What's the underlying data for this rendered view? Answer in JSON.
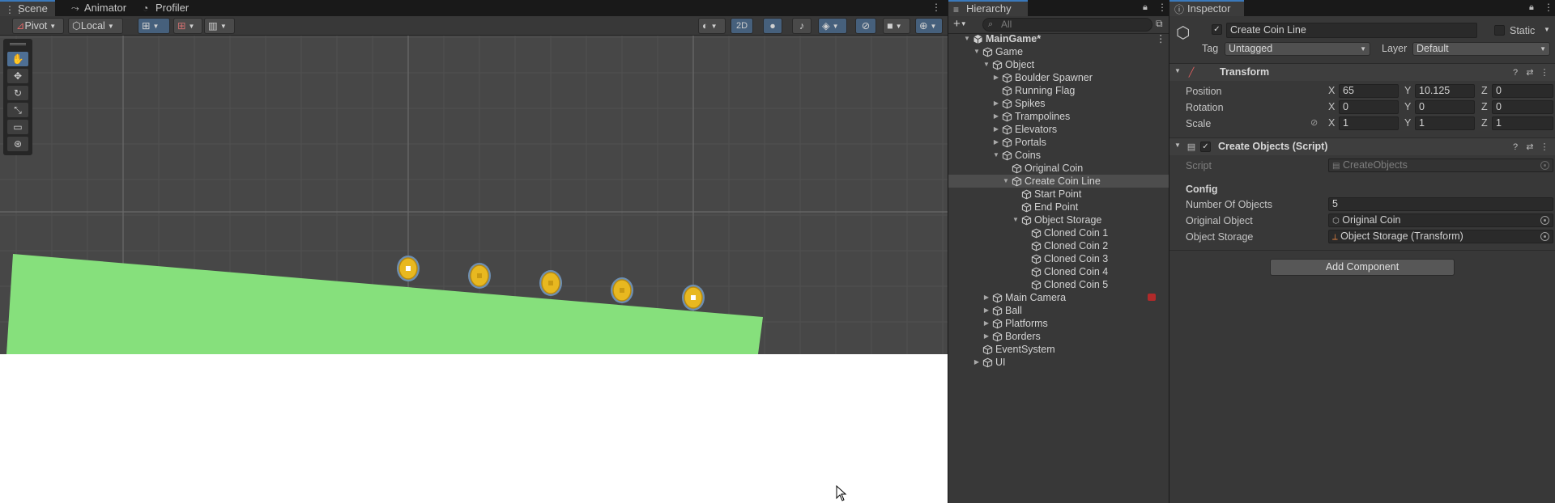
{
  "scene_panel": {
    "tabs": [
      {
        "label": "Scene",
        "icon": "grid-icon",
        "active": true
      },
      {
        "label": "Animator",
        "icon": "animator-icon",
        "active": false
      },
      {
        "label": "Profiler",
        "icon": "profiler-icon",
        "active": false
      }
    ],
    "toolbar": {
      "pivot_label": "Pivot",
      "local_label": "Local",
      "toggle_2d_label": "2D"
    },
    "coins_count": 5
  },
  "hierarchy": {
    "tab_label": "Hierarchy",
    "search_placeholder": "All",
    "rows": [
      {
        "label": "MainGame*",
        "depth": 0,
        "arrow": "open",
        "icon": "scene-icon",
        "bold": true
      },
      {
        "label": "Game",
        "depth": 1,
        "arrow": "open",
        "icon": "cube-icon"
      },
      {
        "label": "Object",
        "depth": 2,
        "arrow": "open",
        "icon": "cube-icon"
      },
      {
        "label": "Boulder Spawner",
        "depth": 3,
        "arrow": "closed",
        "icon": "cube-icon"
      },
      {
        "label": "Running Flag",
        "depth": 3,
        "arrow": "none",
        "icon": "cube-icon"
      },
      {
        "label": "Spikes",
        "depth": 3,
        "arrow": "closed",
        "icon": "cube-icon"
      },
      {
        "label": "Trampolines",
        "depth": 3,
        "arrow": "closed",
        "icon": "cube-icon"
      },
      {
        "label": "Elevators",
        "depth": 3,
        "arrow": "closed",
        "icon": "cube-icon"
      },
      {
        "label": "Portals",
        "depth": 3,
        "arrow": "closed",
        "icon": "cube-icon"
      },
      {
        "label": "Coins",
        "depth": 3,
        "arrow": "open",
        "icon": "cube-icon"
      },
      {
        "label": "Original Coin",
        "depth": 4,
        "arrow": "none",
        "icon": "cube-icon"
      },
      {
        "label": "Create Coin Line",
        "depth": 4,
        "arrow": "open",
        "icon": "cube-icon",
        "selected": true
      },
      {
        "label": "Start Point",
        "depth": 5,
        "arrow": "none",
        "icon": "cube-icon"
      },
      {
        "label": "End Point",
        "depth": 5,
        "arrow": "none",
        "icon": "cube-icon"
      },
      {
        "label": "Object Storage",
        "depth": 5,
        "arrow": "open",
        "icon": "cube-icon"
      },
      {
        "label": "Cloned Coin 1",
        "depth": 6,
        "arrow": "none",
        "icon": "cube-icon"
      },
      {
        "label": "Cloned Coin 2",
        "depth": 6,
        "arrow": "none",
        "icon": "cube-icon"
      },
      {
        "label": "Cloned Coin 3",
        "depth": 6,
        "arrow": "none",
        "icon": "cube-icon"
      },
      {
        "label": "Cloned Coin 4",
        "depth": 6,
        "arrow": "none",
        "icon": "cube-icon"
      },
      {
        "label": "Cloned Coin 5",
        "depth": 6,
        "arrow": "none",
        "icon": "cube-icon"
      },
      {
        "label": "Main Camera",
        "depth": 2,
        "arrow": "closed",
        "icon": "cube-icon",
        "badge": "camera-badge-icon"
      },
      {
        "label": "Ball",
        "depth": 2,
        "arrow": "closed",
        "icon": "cube-icon"
      },
      {
        "label": "Platforms",
        "depth": 2,
        "arrow": "closed",
        "icon": "cube-icon"
      },
      {
        "label": "Borders",
        "depth": 2,
        "arrow": "closed",
        "icon": "cube-icon"
      },
      {
        "label": "EventSystem",
        "depth": 1,
        "arrow": "none",
        "icon": "cube-icon"
      },
      {
        "label": "UI",
        "depth": 1,
        "arrow": "closed",
        "icon": "cube-icon"
      }
    ]
  },
  "inspector": {
    "tab_label": "Inspector",
    "object_name": "Create Coin Line",
    "static_label": "Static",
    "tag_label": "Tag",
    "tag_value": "Untagged",
    "layer_label": "Layer",
    "layer_value": "Default",
    "transform": {
      "title": "Transform",
      "position_label": "Position",
      "rotation_label": "Rotation",
      "scale_label": "Scale",
      "position": {
        "x": "65",
        "y": "10.125",
        "z": "0"
      },
      "rotation": {
        "x": "0",
        "y": "0",
        "z": "0"
      },
      "scale": {
        "x": "1",
        "y": "1",
        "z": "1"
      }
    },
    "script_component": {
      "title": "Create Objects (Script)",
      "script_label": "Script",
      "script_value": "CreateObjects",
      "config_header": "Config",
      "number_label": "Number Of Objects",
      "number_value": "5",
      "original_label": "Original Object",
      "original_value": "Original Coin",
      "storage_label": "Object Storage",
      "storage_value": "Object Storage (Transform)"
    },
    "add_component_label": "Add Component"
  },
  "colors": {
    "accent": "#3a79bb",
    "ground": "#86e07c",
    "coin": "#e8b820",
    "selection": "#4d4d4d"
  }
}
